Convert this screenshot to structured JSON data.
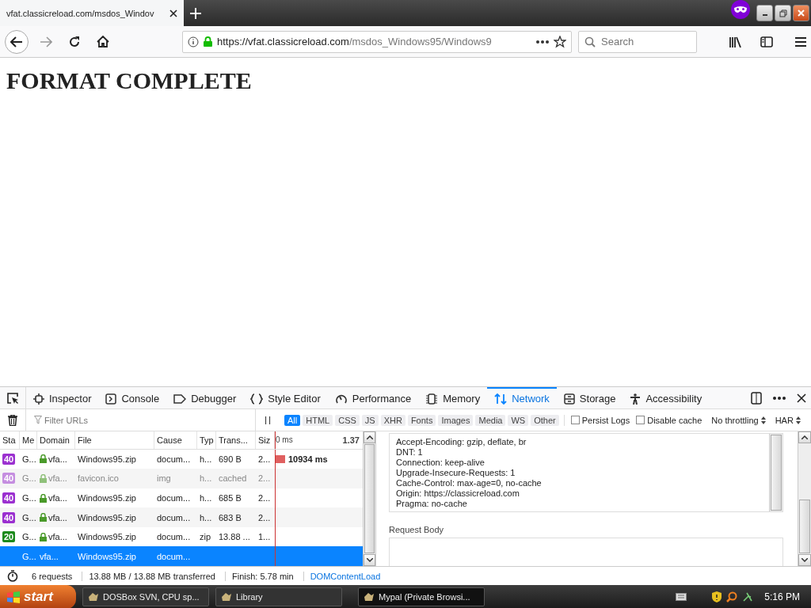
{
  "browser": {
    "tab": {
      "title": "vfat.classicreload.com/msdos_Windov"
    },
    "url": {
      "secure": true,
      "scheme": "https://",
      "host": "vfat.classicreload.com",
      "path": "/msdos_Windows95/Windows9"
    },
    "search": {
      "placeholder": "Search"
    }
  },
  "page": {
    "heading": "FORMAT COMPLETE"
  },
  "devtools": {
    "tabs": [
      {
        "label": "Inspector",
        "selected": false
      },
      {
        "label": "Console",
        "selected": false
      },
      {
        "label": "Debugger",
        "selected": false
      },
      {
        "label": "Style Editor",
        "selected": false
      },
      {
        "label": "Performance",
        "selected": false
      },
      {
        "label": "Memory",
        "selected": false
      },
      {
        "label": "Network",
        "selected": true
      },
      {
        "label": "Storage",
        "selected": false
      },
      {
        "label": "Accessibility",
        "selected": false
      }
    ],
    "filter": {
      "placeholder": "Filter URLs"
    },
    "type_filters": [
      {
        "label": "All",
        "selected": true
      },
      {
        "label": "HTML",
        "selected": false
      },
      {
        "label": "CSS",
        "selected": false
      },
      {
        "label": "JS",
        "selected": false
      },
      {
        "label": "XHR",
        "selected": false
      },
      {
        "label": "Fonts",
        "selected": false
      },
      {
        "label": "Images",
        "selected": false
      },
      {
        "label": "Media",
        "selected": false
      },
      {
        "label": "WS",
        "selected": false
      },
      {
        "label": "Other",
        "selected": false
      }
    ],
    "options": [
      {
        "label": "Persist Logs",
        "checked": false
      },
      {
        "label": "Disable cache",
        "checked": false
      }
    ],
    "dropdowns": [
      "No throttling",
      "HAR"
    ],
    "table": {
      "columns": [
        "Sta",
        "Me",
        "Domain",
        "File",
        "Cause",
        "Typ",
        "Trans...",
        "Siz"
      ],
      "waterfall_ticks": [
        "0 ms",
        "1.37"
      ],
      "rows": [
        {
          "status": "40",
          "color": "#9b30d0",
          "method": "G...",
          "domain": "vfa...",
          "file": "Windows95.zip",
          "cause": "docum...",
          "type": "h...",
          "transferred": "690 B",
          "size": "2...",
          "timing": "10934 ms",
          "faded": false,
          "selected": false
        },
        {
          "status": "40",
          "color": "#c58ee0",
          "method": "G...",
          "domain": "vfa...",
          "file": "favicon.ico",
          "cause": "img",
          "type": "h...",
          "transferred": "cached",
          "size": "2...",
          "faded": true,
          "selected": false
        },
        {
          "status": "40",
          "color": "#9b30d0",
          "method": "G...",
          "domain": "vfa...",
          "file": "Windows95.zip",
          "cause": "docum...",
          "type": "h...",
          "transferred": "685 B",
          "size": "2...",
          "faded": false,
          "selected": false
        },
        {
          "status": "40",
          "color": "#9b30d0",
          "method": "G...",
          "domain": "vfa...",
          "file": "Windows95.zip",
          "cause": "docum...",
          "type": "h...",
          "transferred": "683 B",
          "size": "2...",
          "faded": false,
          "selected": false
        },
        {
          "status": "20",
          "color": "#1c8a1c",
          "method": "G...",
          "domain": "vfa...",
          "file": "Windows95.zip",
          "cause": "docum...",
          "type": "zip",
          "transferred": "13.88 ...",
          "size": "1...",
          "faded": false,
          "selected": false
        },
        {
          "method": "G...",
          "domain": "vfa...",
          "file": "Windows95.zip",
          "cause": "docum...",
          "faded": false,
          "selected": true
        }
      ]
    },
    "headers": [
      "Accept-Encoding: gzip, deflate, br",
      "DNT: 1",
      "Connection: keep-alive",
      "Upgrade-Insecure-Requests: 1",
      "Cache-Control: max-age=0, no-cache",
      "Origin: https://classicreload.com",
      "Pragma: no-cache"
    ],
    "request_body_label": "Request Body",
    "status_bar": [
      "6 requests",
      "13.88 MB / 13.88 MB transferred",
      "Finish: 5.78 min",
      "DOMContentLoad"
    ]
  },
  "taskbar": {
    "start": "start",
    "items": [
      {
        "label": "DOSBox SVN, CPU sp...",
        "selected": false
      },
      {
        "label": "Library",
        "selected": false
      },
      {
        "label": "Mypal (Private Browsi...",
        "selected": true
      }
    ],
    "time": "5:16 PM"
  }
}
